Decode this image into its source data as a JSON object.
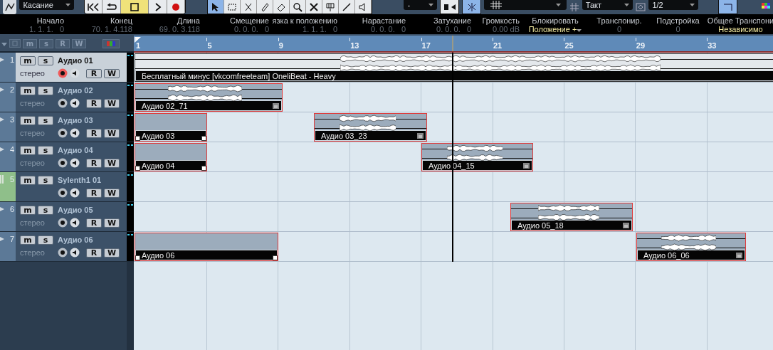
{
  "toolbar": {
    "automation_mode": "Касание",
    "nudge_value": "-",
    "snap_type": "Такт",
    "quantize": "1/2"
  },
  "info_line": [
    {
      "label": "Начало",
      "value": "1. 1. 1.   0",
      "kind": "plain"
    },
    {
      "label": "Конец",
      "value": "70. 1. 4.118",
      "kind": "plain"
    },
    {
      "label": "Длина",
      "value": "69. 0. 3.118",
      "kind": "plain"
    },
    {
      "label": "Смещение",
      "value": "0. 0. 0.   0",
      "kind": "plain"
    },
    {
      "label": "язка к положению",
      "value": "1. 1. 1.   0",
      "kind": "plain"
    },
    {
      "label": "Нарастание",
      "value": "0. 0. 0.   0",
      "kind": "plain"
    },
    {
      "label": "Затухание",
      "value": "0. 0. 0.   0",
      "kind": "plain"
    },
    {
      "label": "Громкость",
      "value": "0.00 dB",
      "kind": "plain"
    },
    {
      "label": "Блокировать",
      "value": "Положение +",
      "kind": "dropdown"
    },
    {
      "label": "Транспонир.",
      "value": "0",
      "kind": "plain"
    },
    {
      "label": "Подстройка",
      "value": "0",
      "kind": "plain"
    },
    {
      "label": "Общее Транспони",
      "value": "Независимо",
      "kind": "choice"
    }
  ],
  "header_buttons": [
    "m",
    "s",
    "R",
    "W"
  ],
  "ruler": {
    "marks": [
      "1",
      "5",
      "9",
      "13",
      "17",
      "21",
      "25",
      "29",
      "33"
    ]
  },
  "tracks": [
    {
      "number": "1",
      "name": "Аудио 01",
      "channel": "стерео",
      "kind": "audio",
      "selected": true,
      "record_armed": true,
      "buttons": [
        "m",
        "s",
        "R",
        "W"
      ],
      "parts": [
        {
          "name": "Бесплатный минус [vkcomfreeteam] OneliBeat - Heavy",
          "kind": "audio",
          "selected": false
        }
      ]
    },
    {
      "number": "2",
      "name": "Аудио 02",
      "channel": "стерео",
      "kind": "audio",
      "selected": false,
      "record_armed": false,
      "buttons": [
        "m",
        "s",
        "R",
        "W"
      ],
      "parts": [
        {
          "name": "Аудио 02_71",
          "kind": "audio",
          "selected": true
        }
      ]
    },
    {
      "number": "3",
      "name": "Аудио 03",
      "channel": "стерео",
      "kind": "audio",
      "selected": false,
      "record_armed": false,
      "buttons": [
        "m",
        "s",
        "R",
        "W"
      ],
      "parts": [
        {
          "name": "Аудио 03",
          "kind": "empty",
          "selected": true
        },
        {
          "name": "Аудио 03_23",
          "kind": "audio",
          "selected": true
        }
      ]
    },
    {
      "number": "4",
      "name": "Аудио 04",
      "channel": "стерео",
      "kind": "audio",
      "selected": false,
      "record_armed": false,
      "buttons": [
        "m",
        "s",
        "R",
        "W"
      ],
      "parts": [
        {
          "name": "Аудио 04",
          "kind": "empty",
          "selected": true
        },
        {
          "name": "Аудио 04_15",
          "kind": "audio",
          "selected": true
        }
      ]
    },
    {
      "number": "5",
      "name": "Sylenth1 01",
      "kind": "instrument",
      "selected": false,
      "record_armed": false,
      "buttons": [
        "m",
        "s",
        "R",
        "W"
      ]
    },
    {
      "number": "6",
      "name": "Аудио 05",
      "channel": "стерео",
      "kind": "audio",
      "selected": false,
      "record_armed": false,
      "buttons": [
        "m",
        "s",
        "R",
        "W"
      ],
      "parts": [
        {
          "name": "Аудио 05_18",
          "kind": "audio",
          "selected": true
        }
      ]
    },
    {
      "number": "7",
      "name": "Аудио 06",
      "channel": "стерео",
      "kind": "audio",
      "selected": false,
      "record_armed": false,
      "buttons": [
        "m",
        "s",
        "R",
        "W"
      ],
      "parts": [
        {
          "name": "Аудио 06",
          "kind": "empty",
          "selected": true
        },
        {
          "name": "Аудио 06_06",
          "kind": "audio",
          "selected": true
        }
      ]
    }
  ]
}
